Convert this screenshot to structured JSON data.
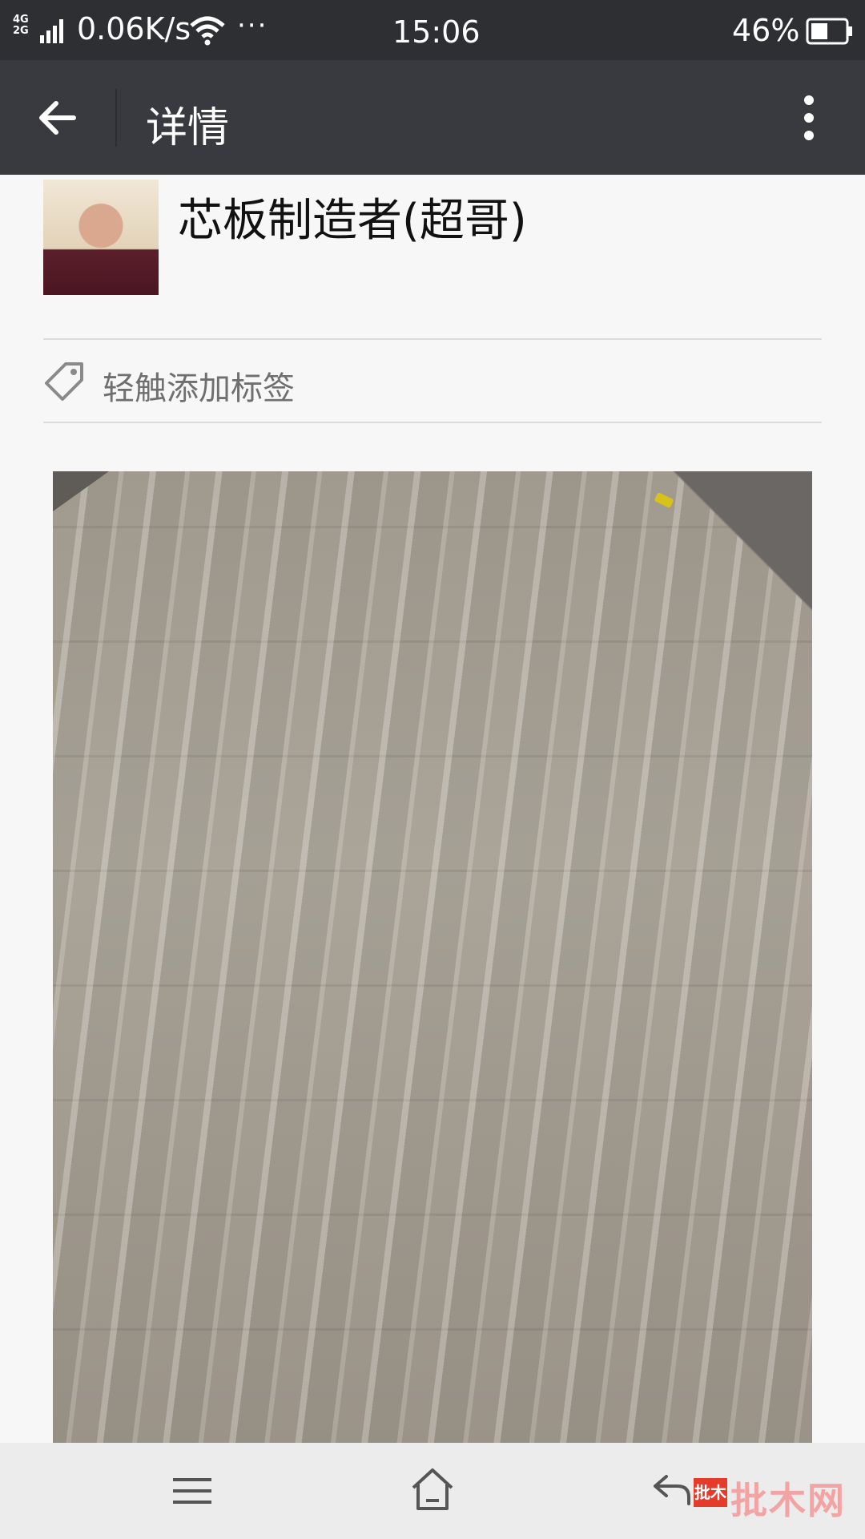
{
  "status_bar": {
    "network_top": "4G",
    "network_bottom": "2G",
    "speed": "0.06K/s",
    "more": "···",
    "time": "15:06",
    "battery": "46%"
  },
  "header": {
    "title": "详情"
  },
  "contact": {
    "name": "芯板制造者(超哥)"
  },
  "tag_row": {
    "label": "轻触添加标签"
  },
  "watermark": {
    "logo_text": "批木",
    "site_text": "批木网"
  },
  "colors": {
    "status_bar_bg": "#2e2f33",
    "app_bar_bg": "#393a3f",
    "page_bg": "#f7f7f7",
    "nav_bar_bg": "#ececec"
  }
}
